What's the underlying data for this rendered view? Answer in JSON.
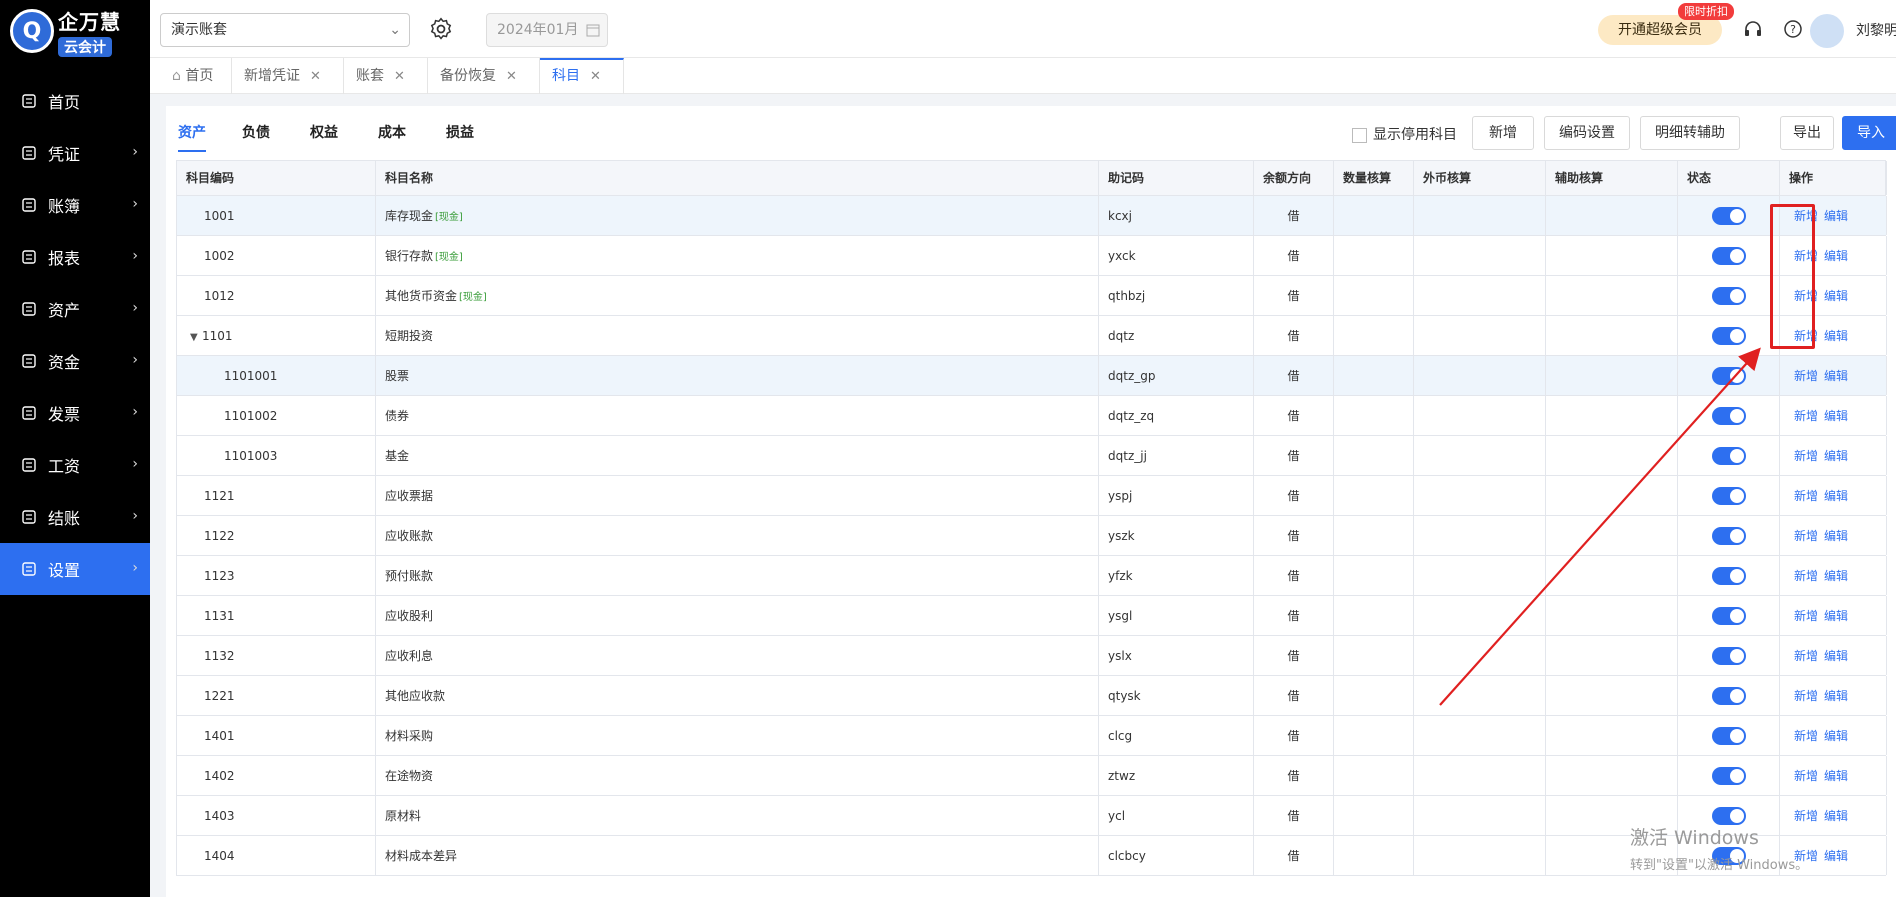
{
  "app": {
    "logo_line1": "企万慧",
    "logo_line2": "云会计"
  },
  "sidebar": {
    "items": [
      {
        "label": "首页",
        "icon": "home-icon",
        "chevron": false
      },
      {
        "label": "凭证",
        "icon": "voucher-icon",
        "chevron": true
      },
      {
        "label": "账簿",
        "icon": "ledger-icon",
        "chevron": true
      },
      {
        "label": "报表",
        "icon": "report-icon",
        "chevron": true
      },
      {
        "label": "资产",
        "icon": "asset-icon",
        "chevron": true
      },
      {
        "label": "资金",
        "icon": "fund-icon",
        "chevron": true
      },
      {
        "label": "发票",
        "icon": "invoice-icon",
        "chevron": true
      },
      {
        "label": "工资",
        "icon": "salary-icon",
        "chevron": true
      },
      {
        "label": "结账",
        "icon": "closing-icon",
        "chevron": true
      },
      {
        "label": "设置",
        "icon": "settings-icon",
        "chevron": true,
        "active": true
      }
    ]
  },
  "header": {
    "account_select": "演示账套",
    "period": "2024年01月",
    "vip_button": "开通超级会员",
    "promo_badge": "限时折扣",
    "user_name": "刘黎明"
  },
  "tabs": [
    {
      "label": "首页",
      "closable": false
    },
    {
      "label": "新增凭证",
      "closable": true
    },
    {
      "label": "账套",
      "closable": true
    },
    {
      "label": "备份恢复",
      "closable": true
    },
    {
      "label": "科目",
      "closable": true,
      "active": true
    }
  ],
  "category_tabs": [
    "资产",
    "负债",
    "权益",
    "成本",
    "损益"
  ],
  "toolbar": {
    "show_disabled_label": "显示停用科目",
    "add": "新增",
    "code_settings": "编码设置",
    "detail_to_aux": "明细转辅助",
    "export": "导出",
    "import": "导入"
  },
  "table": {
    "headers": [
      "科目编码",
      "科目名称",
      "助记码",
      "余额方向",
      "数量核算",
      "外币核算",
      "辅助核算",
      "状态",
      "操作"
    ],
    "op_add": "新增",
    "op_edit": "编辑",
    "rows": [
      {
        "code": "1001",
        "name": "库存现金",
        "tag": "[现金]",
        "mnemonic": "kcxj",
        "direction": "借",
        "indent": 1,
        "highlight": true
      },
      {
        "code": "1002",
        "name": "银行存款",
        "tag": "[现金]",
        "mnemonic": "yxck",
        "direction": "借",
        "indent": 1
      },
      {
        "code": "1012",
        "name": "其他货币资金",
        "tag": "[现金]",
        "mnemonic": "qthbzj",
        "direction": "借",
        "indent": 1
      },
      {
        "code": "1101",
        "name": "短期投资",
        "tag": "",
        "mnemonic": "dqtz",
        "direction": "借",
        "indent": 1,
        "expanded": true
      },
      {
        "code": "1101001",
        "name": "股票",
        "tag": "",
        "mnemonic": "dqtz_gp",
        "direction": "借",
        "indent": 2,
        "highlight": true
      },
      {
        "code": "1101002",
        "name": "债券",
        "tag": "",
        "mnemonic": "dqtz_zq",
        "direction": "借",
        "indent": 2
      },
      {
        "code": "1101003",
        "name": "基金",
        "tag": "",
        "mnemonic": "dqtz_jj",
        "direction": "借",
        "indent": 2
      },
      {
        "code": "1121",
        "name": "应收票据",
        "tag": "",
        "mnemonic": "yspj",
        "direction": "借",
        "indent": 1
      },
      {
        "code": "1122",
        "name": "应收账款",
        "tag": "",
        "mnemonic": "yszk",
        "direction": "借",
        "indent": 1
      },
      {
        "code": "1123",
        "name": "预付账款",
        "tag": "",
        "mnemonic": "yfzk",
        "direction": "借",
        "indent": 1
      },
      {
        "code": "1131",
        "name": "应收股利",
        "tag": "",
        "mnemonic": "ysgl",
        "direction": "借",
        "indent": 1
      },
      {
        "code": "1132",
        "name": "应收利息",
        "tag": "",
        "mnemonic": "yslx",
        "direction": "借",
        "indent": 1
      },
      {
        "code": "1221",
        "name": "其他应收款",
        "tag": "",
        "mnemonic": "qtysk",
        "direction": "借",
        "indent": 1
      },
      {
        "code": "1401",
        "name": "材料采购",
        "tag": "",
        "mnemonic": "clcg",
        "direction": "借",
        "indent": 1
      },
      {
        "code": "1402",
        "name": "在途物资",
        "tag": "",
        "mnemonic": "ztwz",
        "direction": "借",
        "indent": 1
      },
      {
        "code": "1403",
        "name": "原材料",
        "tag": "",
        "mnemonic": "ycl",
        "direction": "借",
        "indent": 1
      },
      {
        "code": "1404",
        "name": "材料成本差异",
        "tag": "",
        "mnemonic": "clcbcy",
        "direction": "借",
        "indent": 1
      }
    ]
  },
  "watermark": {
    "line1": "激活 Windows",
    "line2": "转到\"设置\"以激活 Windows。"
  },
  "colors": {
    "accent": "#2d6ff0",
    "sidebar_bg": "#000000",
    "annotation_red": "#e02020"
  }
}
